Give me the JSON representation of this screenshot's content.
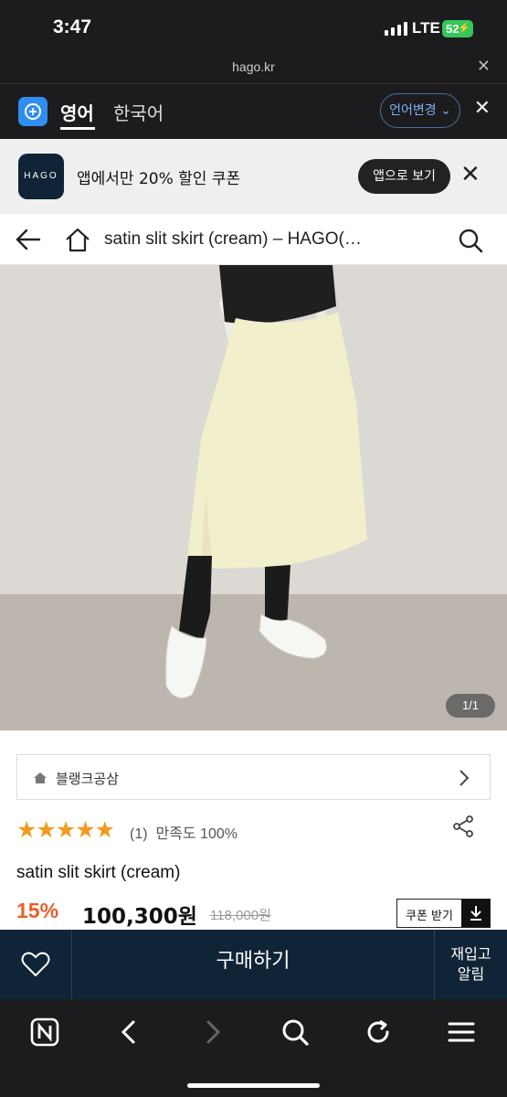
{
  "status": {
    "time": "3:47",
    "network": "LTE",
    "battery": "52"
  },
  "browser": {
    "url": "hago.kr",
    "close_symbol": "✕"
  },
  "translate": {
    "lang_from": "영어",
    "lang_to": "한국어",
    "change_label": "언어변경",
    "close_symbol": "✕"
  },
  "app_banner": {
    "logo_text": "HAGO",
    "message": "앱에서만 20% 할인 쿠폰",
    "open_app_label": "앱으로 보기"
  },
  "header": {
    "title": "satin slit skirt (cream) – HAGO(…"
  },
  "gallery": {
    "counter": "1/1"
  },
  "product": {
    "shop_name": "블랭크공삼",
    "stars": "★★★★★",
    "rating_value": 5,
    "review_count": "(1)",
    "satisfaction": "만족도 100%",
    "name": "satin slit skirt (cream)",
    "discount": "15%",
    "price": "100,300원",
    "original_price": "118,000원",
    "coupon_label": "쿠폰 받기"
  },
  "actions": {
    "buy_label": "구매하기",
    "restock_line1": "재입고",
    "restock_line2": "알림"
  },
  "colors": {
    "navy": "#0f2436",
    "discount_orange": "#e8602c",
    "star": "#f39a1e",
    "accent_blue": "#2f8ef0"
  }
}
